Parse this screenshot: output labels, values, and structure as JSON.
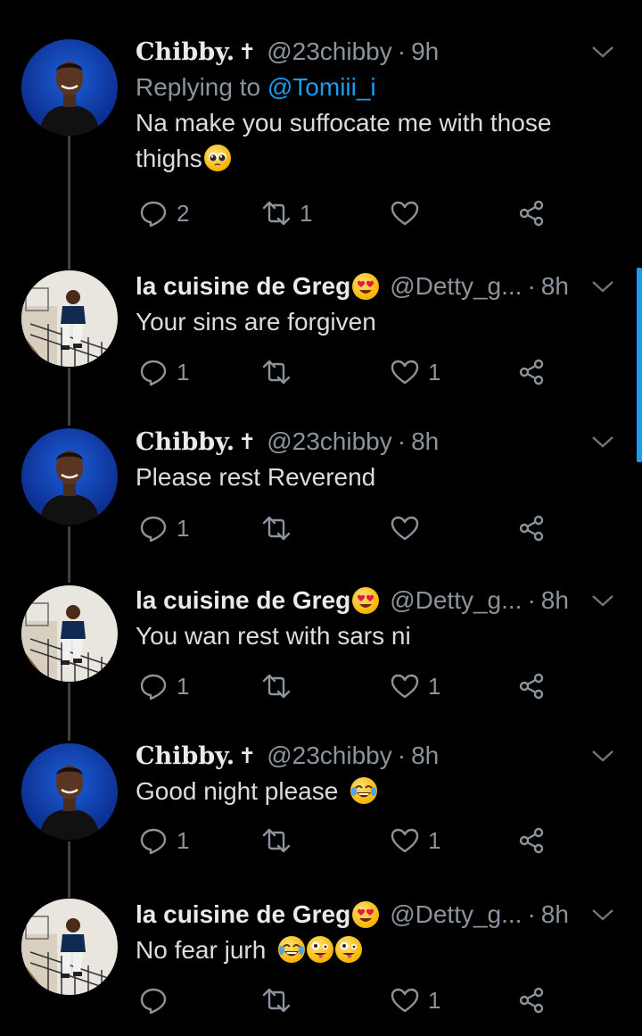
{
  "colors": {
    "background": "#000000",
    "text": "#dcdcdc",
    "muted": "#8b949c",
    "accent": "#1d9bf0"
  },
  "tweets": [
    {
      "author": "Chibby.",
      "author_style": "gothic",
      "handle": "@23chibby",
      "time": "9h",
      "reply_prefix": "Replying to",
      "reply_mention": "@Tomiii_i",
      "text": "Na make you suffocate me with those thighs",
      "text_emojis": [
        "pleading-face"
      ],
      "replies": "2",
      "retweets": "1",
      "likes": ""
    },
    {
      "author": "la cuisine de Greg",
      "author_emoji": "heart-eyes",
      "handle": "@Detty_g...",
      "time": "8h",
      "text": "Your sins are forgiven",
      "replies": "1",
      "retweets": "",
      "likes": "1"
    },
    {
      "author": "Chibby.",
      "author_style": "gothic",
      "handle": "@23chibby",
      "time": "8h",
      "text": "Please rest Reverend",
      "replies": "1",
      "retweets": "",
      "likes": ""
    },
    {
      "author": "la cuisine de Greg",
      "author_emoji": "heart-eyes",
      "handle": "@Detty_g...",
      "time": "8h",
      "text": "You wan rest with sars ni",
      "replies": "1",
      "retweets": "",
      "likes": "1"
    },
    {
      "author": "Chibby.",
      "author_style": "gothic",
      "handle": "@23chibby",
      "time": "8h",
      "text": "Good night please",
      "text_emojis": [
        "tears-of-joy"
      ],
      "replies": "1",
      "retweets": "",
      "likes": "1"
    },
    {
      "author": "la cuisine de Greg",
      "author_emoji": "heart-eyes",
      "handle": "@Detty_g...",
      "time": "8h",
      "text": "No fear jurh",
      "text_emojis": [
        "tears-of-joy",
        "zany-face",
        "zany-face"
      ],
      "replies": "",
      "retweets": "",
      "likes": "1"
    }
  ],
  "separator": "·",
  "icons": [
    "reply-icon",
    "retweet-icon",
    "like-icon",
    "share-icon",
    "chevron-down-icon"
  ]
}
